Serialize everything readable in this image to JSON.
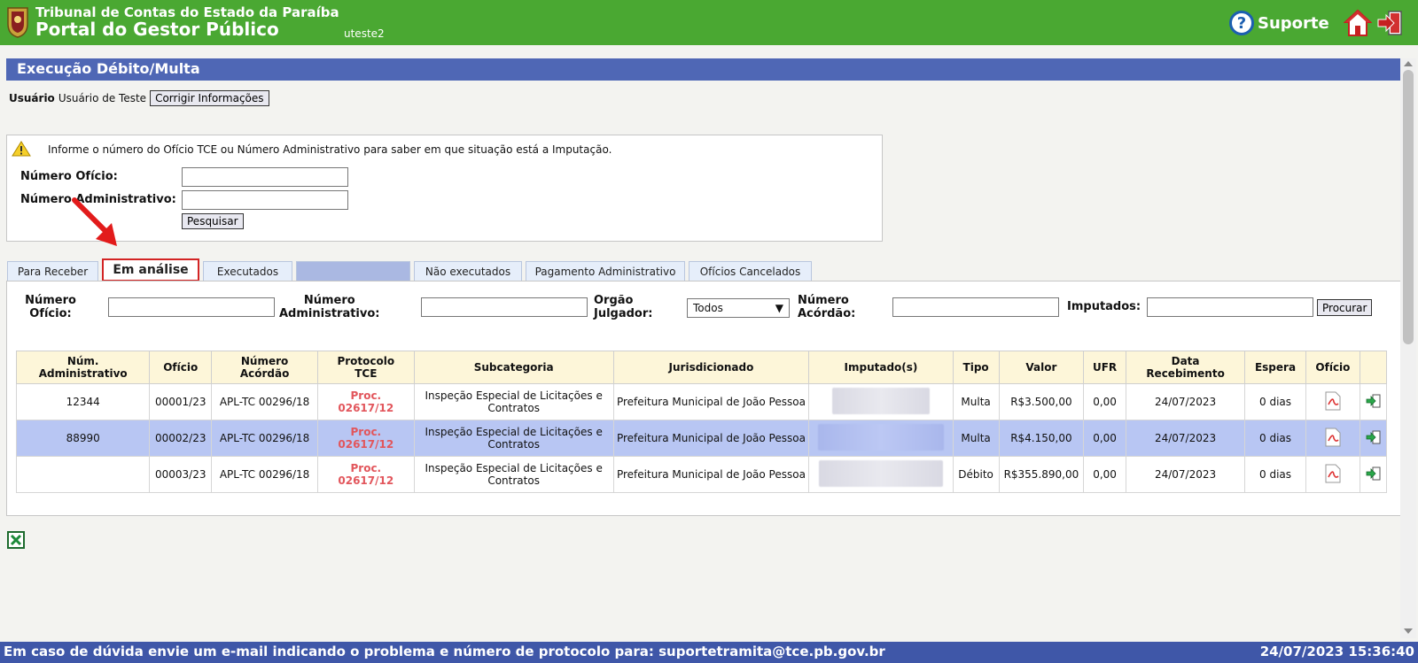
{
  "header": {
    "org": "Tribunal de Contas do Estado da Paraíba",
    "portal": "Portal do Gestor Público",
    "username": "uteste2",
    "support_label": "Suporte",
    "support_icon": "help-icon",
    "home_icon": "home-icon",
    "exit_icon": "exit-icon"
  },
  "page": {
    "title": "Execução Débito/Multa",
    "user_label": "Usuário",
    "user_value": "Usuário de Teste",
    "fix_button": "Corrigir Informações"
  },
  "search": {
    "info": "Informe o número do Ofício TCE ou Número Administrativo para saber em que situação está a Imputação.",
    "oficio_label": "Número Ofício:",
    "oficio_value": "",
    "adm_label": "Número Administrativo:",
    "adm_value": "",
    "button": "Pesquisar"
  },
  "tabs": [
    {
      "label": "Para Receber"
    },
    {
      "label": "Em análise"
    },
    {
      "label": "Executados"
    },
    {
      "label": ""
    },
    {
      "label": "Não executados"
    },
    {
      "label": "Pagamento Administrativo"
    },
    {
      "label": "Ofícios Cancelados"
    }
  ],
  "filters": {
    "oficio_label": "Número\nOfício:",
    "adm_label": "Número\nAdministrativo:",
    "orgao_label": "Orgão\nJulgador:",
    "orgao_value": "Todos",
    "acordao_label": "Número\nAcórdão:",
    "imputados_label": "Imputados:",
    "button": "Procurar"
  },
  "table": {
    "headers": [
      "Núm.\nAdministrativo",
      "Ofício",
      "Número\nAcórdão",
      "Protocolo\nTCE",
      "Subcategoria",
      "Jurisdicionado",
      "Imputado(s)",
      "Tipo",
      "Valor",
      "UFR",
      "Data\nRecebimento",
      "Espera",
      "Ofício",
      ""
    ],
    "rows": [
      {
        "adm": "12344",
        "oficio": "00001/23",
        "acordao": "APL-TC 00296/18",
        "protocolo": "Proc.\n02617/12",
        "sub": "Inspeção Especial de Licitações e Contratos",
        "jur": "Prefeitura Municipal de João Pessoa",
        "tipo": "Multa",
        "valor": "R$3.500,00",
        "ufr": "0,00",
        "data": "24/07/2023",
        "espera": "0 dias"
      },
      {
        "adm": "88990",
        "oficio": "00002/23",
        "acordao": "APL-TC 00296/18",
        "protocolo": "Proc.\n02617/12",
        "sub": "Inspeção Especial de Licitações e Contratos",
        "jur": "Prefeitura Municipal de João Pessoa",
        "tipo": "Multa",
        "valor": "R$4.150,00",
        "ufr": "0,00",
        "data": "24/07/2023",
        "espera": "0 dias"
      },
      {
        "adm": "",
        "oficio": "00003/23",
        "acordao": "APL-TC 00296/18",
        "protocolo": "Proc.\n02617/12",
        "sub": "Inspeção Especial de Licitações e Contratos",
        "jur": "Prefeitura Municipal de João Pessoa",
        "tipo": "Débito",
        "valor": "R$355.890,00",
        "ufr": "0,00",
        "data": "24/07/2023",
        "espera": "0 dias"
      }
    ]
  },
  "footer": {
    "message": "Em caso de dúvida envie um e-mail indicando o problema e número de protocolo para: suportetramita@tce.pb.gov.br",
    "datetime": "24/07/2023 15:36:40"
  }
}
